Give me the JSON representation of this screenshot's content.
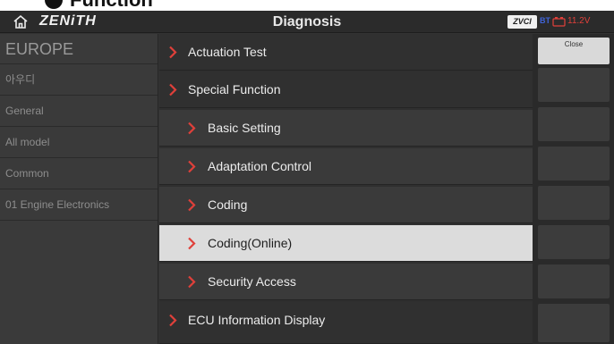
{
  "caption": {
    "text": "Function"
  },
  "titlebar": {
    "brand": "ZENiTH",
    "title": "Diagnosis",
    "vci_badge": "ZVCI",
    "vci_status": "BT",
    "voltage": "11.2V",
    "accent_color": "#e0403a"
  },
  "sidebar": {
    "region": "EUROPE",
    "items": [
      {
        "label": "아우디"
      },
      {
        "label": "General"
      },
      {
        "label": "All model"
      },
      {
        "label": "Common"
      },
      {
        "label": "01 Engine Electronics"
      }
    ]
  },
  "menu": {
    "items": [
      {
        "label": "Actuation Test",
        "level": 1,
        "selected": false
      },
      {
        "label": "Special Function",
        "level": 1,
        "selected": false
      },
      {
        "label": "Basic Setting",
        "level": 2,
        "selected": false
      },
      {
        "label": "Adaptation Control",
        "level": 2,
        "selected": false
      },
      {
        "label": "Coding",
        "level": 2,
        "selected": false
      },
      {
        "label": "Coding(Online)",
        "level": 2,
        "selected": true
      },
      {
        "label": "Security Access",
        "level": 2,
        "selected": false
      },
      {
        "label": "ECU Information Display",
        "level": 1,
        "selected": false
      }
    ]
  },
  "actions": {
    "close_label": "Close"
  }
}
